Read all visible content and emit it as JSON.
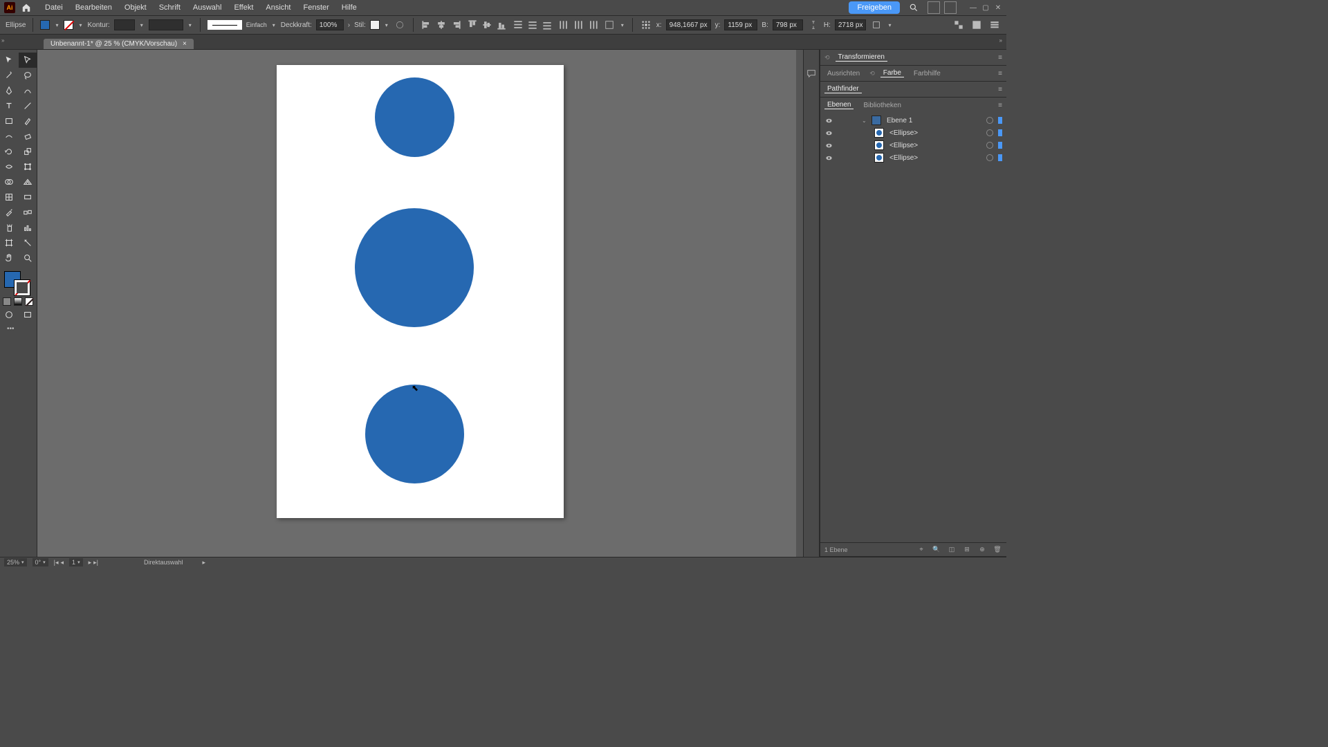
{
  "menubar": {
    "items": [
      "Datei",
      "Bearbeiten",
      "Objekt",
      "Schrift",
      "Auswahl",
      "Effekt",
      "Ansicht",
      "Fenster",
      "Hilfe"
    ],
    "freigeben": "Freigeben"
  },
  "controlbar": {
    "shape_label": "Ellipse",
    "fill_color": "#2668b1",
    "stroke_label": "Kontur:",
    "brush_label": "Einfach",
    "opacity_label": "Deckkraft:",
    "opacity_value": "100%",
    "style_label": "Stil:",
    "x_label": "x:",
    "x_value": "948,1667 px",
    "y_label": "y:",
    "y_value": "1159 px",
    "w_label": "B:",
    "w_value": "798 px",
    "h_label": "H:",
    "h_value": "2718 px"
  },
  "tab": {
    "title": "Unbenannt-1* @ 25 % (CMYK/Vorschau)",
    "close": "×"
  },
  "panels": {
    "transform": "Transformieren",
    "align": "Ausrichten",
    "color": "Farbe",
    "colorguide": "Farbhilfe",
    "pathfinder": "Pathfinder",
    "layers": "Ebenen",
    "libraries": "Bibliotheken"
  },
  "layers": {
    "layer1": "Ebene 1",
    "item_label": "<Ellipse>",
    "footer_text": "1 Ebene"
  },
  "statusbar": {
    "zoom": "25%",
    "rotation": "0°",
    "artboard_num": "1",
    "tool_name": "Direktauswahl"
  },
  "artboard": {
    "circle_color": "#2668b1"
  }
}
